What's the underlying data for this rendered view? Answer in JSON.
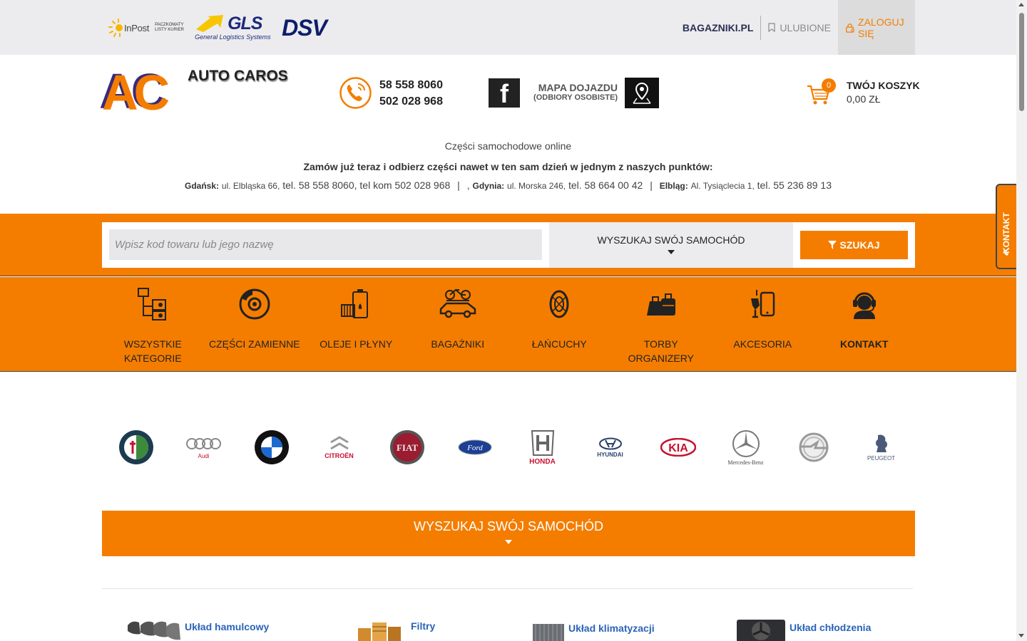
{
  "carriers": {
    "inpost": "InPost",
    "inpost_sub": "PACZKOMATY LISTY KURIER",
    "gls": "GLS",
    "gls_sub": "General Logistics Systems",
    "dsv": "DSV"
  },
  "top_links": {
    "bagazniki": "BAGAZNIKI.PL",
    "favorites": "ULUBIONE",
    "login": "ZALOGUJ SIĘ"
  },
  "logo": {
    "mark": "AC",
    "name": "AUTO CAROS"
  },
  "phones": [
    "58 558 8060",
    "502 028 968"
  ],
  "facebook_glyph": "f",
  "map": {
    "title": "MAPA DOJAZDU",
    "subtitle": "(ODBIORY OSOBISTE)"
  },
  "cart": {
    "title": "TWÓJ KOSZYK",
    "amount": "0,00 ZŁ",
    "count": "0"
  },
  "tagline": "Części samochodowe online",
  "order_line": "Zamów już teraz i odbierz części nawet w ten sam dzień w jednym z naszych punktów:",
  "addresses": {
    "gdansk_city": "Gdańsk:",
    "gdansk_street": "ul. Elbląska 66,",
    "gdansk_phone": "tel. 58 558 8060, tel kom 502 028 968",
    "sep": "|",
    "gdynia_prefix": ",",
    "gdynia_city": "Gdynia:",
    "gdynia_street": "ul. Morska 246,",
    "gdynia_phone": "tel. 58 664 00 42",
    "elblag_city": "Elbląg:",
    "elblag_street": "Al. Tysiąclecia 1,",
    "elblag_phone": "tel. 55 236 89 13"
  },
  "search": {
    "placeholder": "Wpisz kod towaru lub jego nazwę",
    "car_select": "WYSZUKAJ SWÓJ SAMOCHÓD",
    "button": "SZUKAJ"
  },
  "categories": [
    {
      "label": "WSZYSTKIE KATEGORIE",
      "icon": "folder-tree-icon"
    },
    {
      "label": "CZĘŚCI ZAMIENNE",
      "icon": "brake-disc-icon"
    },
    {
      "label": "OLEJE I PŁYNY",
      "icon": "oil-can-icon"
    },
    {
      "label": "BAGAŻNIKI",
      "icon": "car-roof-bike-icon"
    },
    {
      "label": "ŁAŃCUCHY",
      "icon": "snow-chain-icon"
    },
    {
      "label": "TORBY ORGANIZERY",
      "icon": "bags-icon"
    },
    {
      "label": "AKCESORIA",
      "icon": "phone-holder-icon"
    },
    {
      "label": "KONTAKT",
      "icon": "headset-icon"
    }
  ],
  "brands": [
    {
      "label": "",
      "name": "alfa-romeo-logo"
    },
    {
      "label": "Audi",
      "name": "audi-logo"
    },
    {
      "label": "",
      "name": "bmw-logo"
    },
    {
      "label": "CITROËN",
      "name": "citroen-logo"
    },
    {
      "label": "FIAT",
      "name": "fiat-logo"
    },
    {
      "label": "Ford",
      "name": "ford-logo"
    },
    {
      "label": "HONDA",
      "name": "honda-logo"
    },
    {
      "label": "HYUNDAI",
      "name": "hyundai-logo"
    },
    {
      "label": "KIA",
      "name": "kia-logo"
    },
    {
      "label": "Mercedes-Benz",
      "name": "mercedes-logo"
    },
    {
      "label": "",
      "name": "opel-logo"
    },
    {
      "label": "PEUGEOT",
      "name": "peugeot-logo"
    }
  ],
  "banner": "WYSZUKAJ SWÓJ SAMOCHÓD",
  "subcategories": [
    "Układ hamulcowy",
    "Filtry",
    "Układ klimatyzacji",
    "Układ chłodzenia"
  ],
  "side_contact": "KONTAKT",
  "colors": {
    "accent": "#f47d00",
    "link": "#2a63b8",
    "dark": "#222222"
  }
}
